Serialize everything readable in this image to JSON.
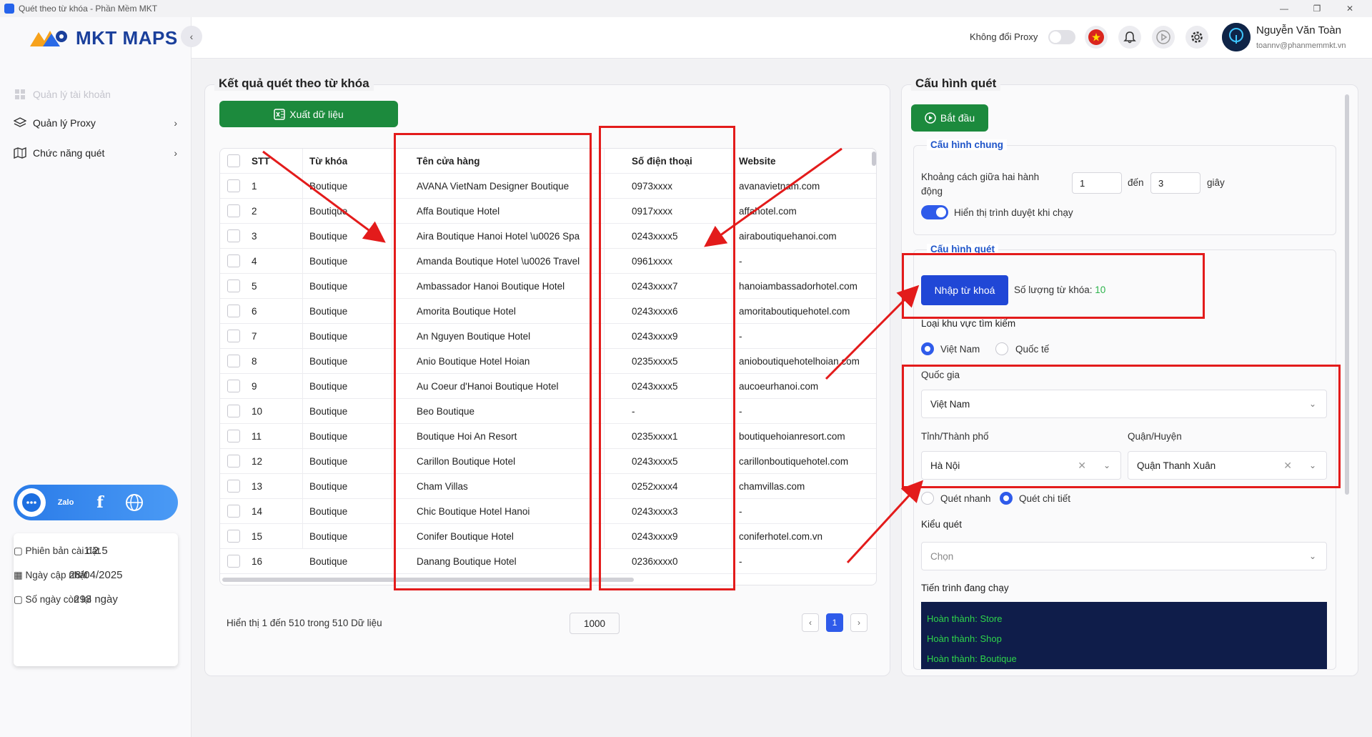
{
  "window": {
    "title": "Quét theo từ khóa - Phần Mềm MKT",
    "minimize": "—",
    "maximize": "❐",
    "close": "✕"
  },
  "logo": {
    "text": "MKT MAPS"
  },
  "sidebar": {
    "items": [
      {
        "label": "Quản lý tài khoản"
      },
      {
        "label": "Quản lý Proxy"
      },
      {
        "label": "Chức năng quét"
      }
    ],
    "social": [
      "chat",
      "Zalo",
      "f",
      "web"
    ],
    "info": {
      "version_label": "Phiên bản cài đặt",
      "version": "1.2.5",
      "update_label": "Ngày cập nhật",
      "update": "28/04/2025",
      "days_label": "Số ngày còn lại",
      "days": "293 ngày"
    }
  },
  "topbar": {
    "proxy_label": "Không đổi Proxy",
    "user_name": "Nguyễn Văn Toàn",
    "user_email": "toannv@phanmemmkt.vn"
  },
  "results": {
    "title": "Kết quả quét theo từ khóa",
    "export_label": "Xuất dữ liệu",
    "columns": [
      "STT",
      "Từ khóa",
      "Tên cửa hàng",
      "Số điện thoại",
      "Website"
    ],
    "rows": [
      [
        "1",
        "Boutique",
        "AVANA VietNam Designer Boutique",
        "0973xxxx",
        "avanavietnam.com"
      ],
      [
        "2",
        "Boutique",
        "Affa Boutique Hotel",
        "0917xxxx",
        "affahotel.com"
      ],
      [
        "3",
        "Boutique",
        "Aira Boutique Hanoi Hotel \\u0026 Spa",
        "0243xxxx5",
        "airaboutiquehanoi.com"
      ],
      [
        "4",
        "Boutique",
        "Amanda Boutique Hotel \\u0026 Travel",
        "0961xxxx",
        "-"
      ],
      [
        "5",
        "Boutique",
        "Ambassador Hanoi Boutique Hotel",
        "0243xxxx7",
        "hanoiambassadorhotel.com"
      ],
      [
        "6",
        "Boutique",
        "Amorita Boutique Hotel",
        "0243xxxx6",
        "amoritaboutiquehotel.com"
      ],
      [
        "7",
        "Boutique",
        "An Nguyen Boutique Hotel",
        "0243xxxx9",
        "-"
      ],
      [
        "8",
        "Boutique",
        "Anio Boutique Hotel Hoian",
        "0235xxxx5",
        "anioboutiquehotelhoian.com"
      ],
      [
        "9",
        "Boutique",
        "Au Coeur d'Hanoi Boutique Hotel",
        "0243xxxx5",
        "aucoeurhanoi.com"
      ],
      [
        "10",
        "Boutique",
        "Beo Boutique",
        "-",
        "-"
      ],
      [
        "11",
        "Boutique",
        "Boutique Hoi An Resort",
        "0235xxxx1",
        "boutiquehoianresort.com"
      ],
      [
        "12",
        "Boutique",
        "Carillon Boutique Hotel",
        "0243xxxx5",
        "carillonboutiquehotel.com"
      ],
      [
        "13",
        "Boutique",
        "Cham Villas",
        "0252xxxx4",
        "chamvillas.com"
      ],
      [
        "14",
        "Boutique",
        "Chic Boutique Hotel Hanoi",
        "0243xxxx3",
        "-"
      ],
      [
        "15",
        "Boutique",
        "Conifer Boutique Hotel",
        "0243xxxx9",
        "coniferhotel.com.vn"
      ],
      [
        "16",
        "Boutique",
        "Danang Boutique Hotel",
        "0236xxxx0",
        "-"
      ]
    ],
    "pagination_text": "Hiển thị 1 đến 510 trong 510 Dữ liệu",
    "page_size": "1000",
    "current_page": "1",
    "prev": "‹",
    "next": "›"
  },
  "config": {
    "title": "Cấu hình quét",
    "start_label": "Bắt đầu",
    "general": {
      "legend": "Cấu hình chung",
      "interval_label": "Khoảng cách giữa hai hành động",
      "from": "1",
      "to_label": "đến",
      "to": "3",
      "unit": "giây",
      "show_browser_label": "Hiển thị trình duyệt khi chạy"
    },
    "scan": {
      "legend": "Cấu hình quét",
      "import_label": "Nhập từ khoá",
      "keyword_count_label": "Số lượng từ khóa:",
      "keyword_count": "10",
      "region_label": "Loại khu vực tìm kiếm",
      "region_options": [
        "Việt Nam",
        "Quốc tế"
      ],
      "country_label": "Quốc gia",
      "country": "Việt Nam",
      "province_label": "Tỉnh/Thành phố",
      "province": "Hà Nội",
      "district_label": "Quận/Huyện",
      "district": "Quận Thanh Xuân",
      "mode_options": [
        "Quét nhanh",
        "Quét chi tiết"
      ],
      "scan_type_label": "Kiểu quét",
      "scan_type_placeholder": "Chọn",
      "progress_label": "Tiến trình đang chạy",
      "log": [
        "Hoàn thành: Store",
        "Hoàn thành: Shop",
        "Hoàn thành: Boutique"
      ]
    }
  },
  "colors": {
    "accent": "#2f5bea",
    "export_green": "#1c8a3d",
    "annotation_red": "#e31b1b",
    "log_bg": "#0f1d4a",
    "log_text": "#2ed44a"
  }
}
